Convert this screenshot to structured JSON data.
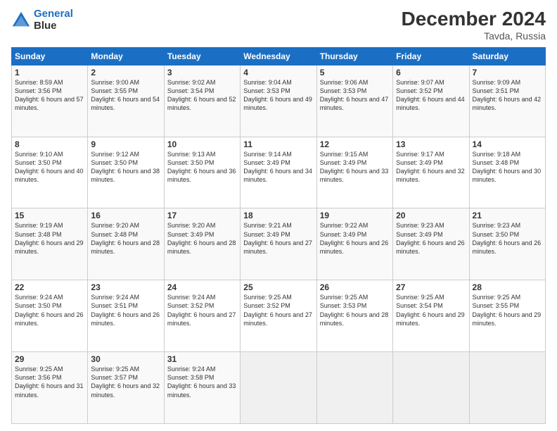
{
  "header": {
    "logo_line1": "General",
    "logo_line2": "Blue",
    "title": "December 2024",
    "subtitle": "Tavda, Russia"
  },
  "weekdays": [
    "Sunday",
    "Monday",
    "Tuesday",
    "Wednesday",
    "Thursday",
    "Friday",
    "Saturday"
  ],
  "weeks": [
    [
      {
        "day": "1",
        "sunrise": "Sunrise: 8:59 AM",
        "sunset": "Sunset: 3:56 PM",
        "daylight": "Daylight: 6 hours and 57 minutes."
      },
      {
        "day": "2",
        "sunrise": "Sunrise: 9:00 AM",
        "sunset": "Sunset: 3:55 PM",
        "daylight": "Daylight: 6 hours and 54 minutes."
      },
      {
        "day": "3",
        "sunrise": "Sunrise: 9:02 AM",
        "sunset": "Sunset: 3:54 PM",
        "daylight": "Daylight: 6 hours and 52 minutes."
      },
      {
        "day": "4",
        "sunrise": "Sunrise: 9:04 AM",
        "sunset": "Sunset: 3:53 PM",
        "daylight": "Daylight: 6 hours and 49 minutes."
      },
      {
        "day": "5",
        "sunrise": "Sunrise: 9:06 AM",
        "sunset": "Sunset: 3:53 PM",
        "daylight": "Daylight: 6 hours and 47 minutes."
      },
      {
        "day": "6",
        "sunrise": "Sunrise: 9:07 AM",
        "sunset": "Sunset: 3:52 PM",
        "daylight": "Daylight: 6 hours and 44 minutes."
      },
      {
        "day": "7",
        "sunrise": "Sunrise: 9:09 AM",
        "sunset": "Sunset: 3:51 PM",
        "daylight": "Daylight: 6 hours and 42 minutes."
      }
    ],
    [
      {
        "day": "8",
        "sunrise": "Sunrise: 9:10 AM",
        "sunset": "Sunset: 3:50 PM",
        "daylight": "Daylight: 6 hours and 40 minutes."
      },
      {
        "day": "9",
        "sunrise": "Sunrise: 9:12 AM",
        "sunset": "Sunset: 3:50 PM",
        "daylight": "Daylight: 6 hours and 38 minutes."
      },
      {
        "day": "10",
        "sunrise": "Sunrise: 9:13 AM",
        "sunset": "Sunset: 3:50 PM",
        "daylight": "Daylight: 6 hours and 36 minutes."
      },
      {
        "day": "11",
        "sunrise": "Sunrise: 9:14 AM",
        "sunset": "Sunset: 3:49 PM",
        "daylight": "Daylight: 6 hours and 34 minutes."
      },
      {
        "day": "12",
        "sunrise": "Sunrise: 9:15 AM",
        "sunset": "Sunset: 3:49 PM",
        "daylight": "Daylight: 6 hours and 33 minutes."
      },
      {
        "day": "13",
        "sunrise": "Sunrise: 9:17 AM",
        "sunset": "Sunset: 3:49 PM",
        "daylight": "Daylight: 6 hours and 32 minutes."
      },
      {
        "day": "14",
        "sunrise": "Sunrise: 9:18 AM",
        "sunset": "Sunset: 3:48 PM",
        "daylight": "Daylight: 6 hours and 30 minutes."
      }
    ],
    [
      {
        "day": "15",
        "sunrise": "Sunrise: 9:19 AM",
        "sunset": "Sunset: 3:48 PM",
        "daylight": "Daylight: 6 hours and 29 minutes."
      },
      {
        "day": "16",
        "sunrise": "Sunrise: 9:20 AM",
        "sunset": "Sunset: 3:48 PM",
        "daylight": "Daylight: 6 hours and 28 minutes."
      },
      {
        "day": "17",
        "sunrise": "Sunrise: 9:20 AM",
        "sunset": "Sunset: 3:49 PM",
        "daylight": "Daylight: 6 hours and 28 minutes."
      },
      {
        "day": "18",
        "sunrise": "Sunrise: 9:21 AM",
        "sunset": "Sunset: 3:49 PM",
        "daylight": "Daylight: 6 hours and 27 minutes."
      },
      {
        "day": "19",
        "sunrise": "Sunrise: 9:22 AM",
        "sunset": "Sunset: 3:49 PM",
        "daylight": "Daylight: 6 hours and 26 minutes."
      },
      {
        "day": "20",
        "sunrise": "Sunrise: 9:23 AM",
        "sunset": "Sunset: 3:49 PM",
        "daylight": "Daylight: 6 hours and 26 minutes."
      },
      {
        "day": "21",
        "sunrise": "Sunrise: 9:23 AM",
        "sunset": "Sunset: 3:50 PM",
        "daylight": "Daylight: 6 hours and 26 minutes."
      }
    ],
    [
      {
        "day": "22",
        "sunrise": "Sunrise: 9:24 AM",
        "sunset": "Sunset: 3:50 PM",
        "daylight": "Daylight: 6 hours and 26 minutes."
      },
      {
        "day": "23",
        "sunrise": "Sunrise: 9:24 AM",
        "sunset": "Sunset: 3:51 PM",
        "daylight": "Daylight: 6 hours and 26 minutes."
      },
      {
        "day": "24",
        "sunrise": "Sunrise: 9:24 AM",
        "sunset": "Sunset: 3:52 PM",
        "daylight": "Daylight: 6 hours and 27 minutes."
      },
      {
        "day": "25",
        "sunrise": "Sunrise: 9:25 AM",
        "sunset": "Sunset: 3:52 PM",
        "daylight": "Daylight: 6 hours and 27 minutes."
      },
      {
        "day": "26",
        "sunrise": "Sunrise: 9:25 AM",
        "sunset": "Sunset: 3:53 PM",
        "daylight": "Daylight: 6 hours and 28 minutes."
      },
      {
        "day": "27",
        "sunrise": "Sunrise: 9:25 AM",
        "sunset": "Sunset: 3:54 PM",
        "daylight": "Daylight: 6 hours and 29 minutes."
      },
      {
        "day": "28",
        "sunrise": "Sunrise: 9:25 AM",
        "sunset": "Sunset: 3:55 PM",
        "daylight": "Daylight: 6 hours and 29 minutes."
      }
    ],
    [
      {
        "day": "29",
        "sunrise": "Sunrise: 9:25 AM",
        "sunset": "Sunset: 3:56 PM",
        "daylight": "Daylight: 6 hours and 31 minutes."
      },
      {
        "day": "30",
        "sunrise": "Sunrise: 9:25 AM",
        "sunset": "Sunset: 3:57 PM",
        "daylight": "Daylight: 6 hours and 32 minutes."
      },
      {
        "day": "31",
        "sunrise": "Sunrise: 9:24 AM",
        "sunset": "Sunset: 3:58 PM",
        "daylight": "Daylight: 6 hours and 33 minutes."
      },
      null,
      null,
      null,
      null
    ]
  ]
}
